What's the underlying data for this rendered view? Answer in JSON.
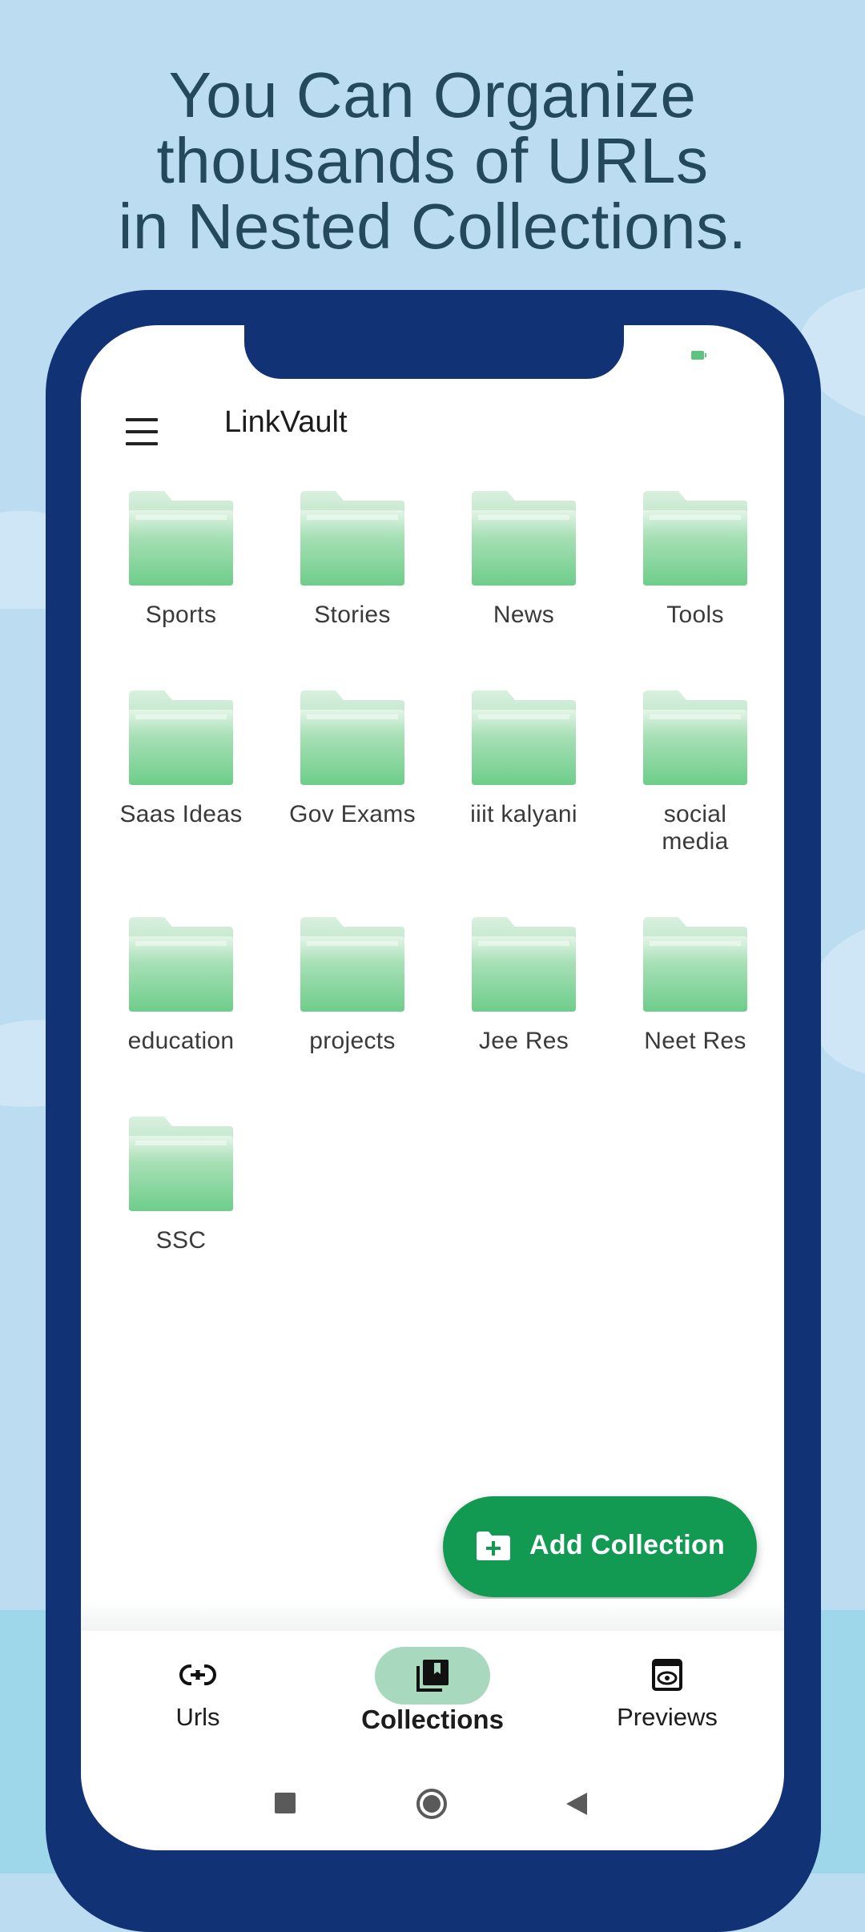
{
  "headline": {
    "line1": "You Can Organize",
    "line2": "thousands of URLs",
    "line3": "in Nested Collections."
  },
  "app": {
    "title": "LinkVault",
    "menu_icon": "hamburger-menu-icon"
  },
  "collections": [
    "Sports",
    "Stories",
    "News",
    "Tools",
    "Saas Ideas",
    "Gov Exams",
    "iiit kalyani",
    "social media",
    "education",
    "projects",
    "Jee Res",
    "Neet Res",
    "SSC"
  ],
  "fab": {
    "label": "Add Collection",
    "icon": "folder-add-icon"
  },
  "bottom_nav": {
    "items": [
      {
        "label": "Urls",
        "icon": "link-icon",
        "active": false
      },
      {
        "label": "Collections",
        "icon": "collections-icon",
        "active": true
      },
      {
        "label": "Previews",
        "icon": "preview-eye-icon",
        "active": false
      }
    ]
  },
  "colors": {
    "background": "#bcdcf1",
    "phone_frame": "#123276",
    "accent_green": "#139a52",
    "active_pill": "#a8d8bd",
    "folder_green": "#7fd597",
    "headline_text": "#24495b"
  }
}
